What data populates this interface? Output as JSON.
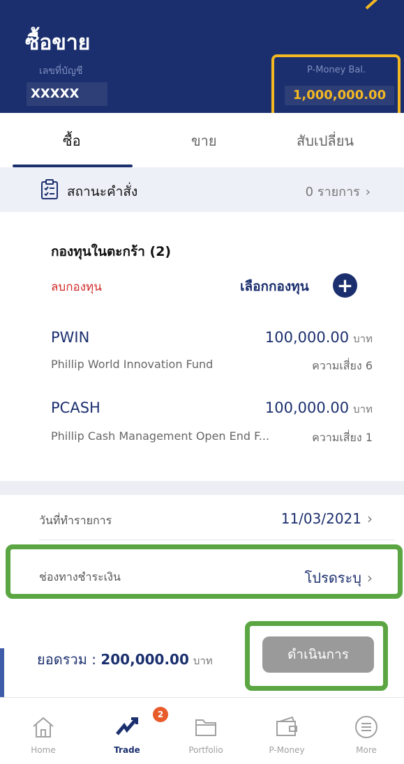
{
  "header": {
    "title": "ซื้อขาย",
    "account_label": "เลขที่บัญชี",
    "account_value": "XXXXX",
    "balance_label": "P-Money Bal.",
    "balance_value": "1,000,000.00"
  },
  "tabs": [
    {
      "label": "ซื้อ",
      "active": true
    },
    {
      "label": "ขาย",
      "active": false
    },
    {
      "label": "สับเปลี่ยน",
      "active": false
    }
  ],
  "order_status": {
    "label": "สถานะคำสั่ง",
    "count": "0 รายการ",
    "icon": "checklist-icon"
  },
  "cart": {
    "title": "กองทุนในตะกร้า (2)",
    "remove_label": "ลบกองทุน",
    "select_label": "เลือกกองทุน",
    "items": [
      {
        "code": "PWIN",
        "amount": "100,000.00",
        "unit": "บาท",
        "name": "Phillip World Innovation Fund",
        "risk": "ความเสี่ยง 6"
      },
      {
        "code": "PCASH",
        "amount": "100,000.00",
        "unit": "บาท",
        "name": "Phillip Cash Management Open End F...",
        "risk": "ความเสี่ยง 1"
      }
    ]
  },
  "transaction_date": {
    "label": "วันที่ทำรายการ",
    "value": "11/03/2021"
  },
  "payment_channel": {
    "label": "ช่องทางชำระเงิน",
    "value": "โปรดระบุ"
  },
  "summary": {
    "total_label": "ยอดรวม :",
    "total_value": "200,000.00",
    "unit": "บาท",
    "proceed_label": "ดำเนินการ"
  },
  "nav": [
    {
      "label": "Home",
      "icon": "home-icon"
    },
    {
      "label": "Trade",
      "icon": "trade-icon",
      "badge": "2",
      "active": true
    },
    {
      "label": "Portfolio",
      "icon": "folder-icon"
    },
    {
      "label": "P-Money",
      "icon": "wallet-icon"
    },
    {
      "label": "More",
      "icon": "menu-icon"
    }
  ],
  "colors": {
    "primary": "#1b2f6e",
    "highlight_yellow": "#f3b822",
    "highlight_green": "#5ba642",
    "danger": "#d12b2b"
  }
}
